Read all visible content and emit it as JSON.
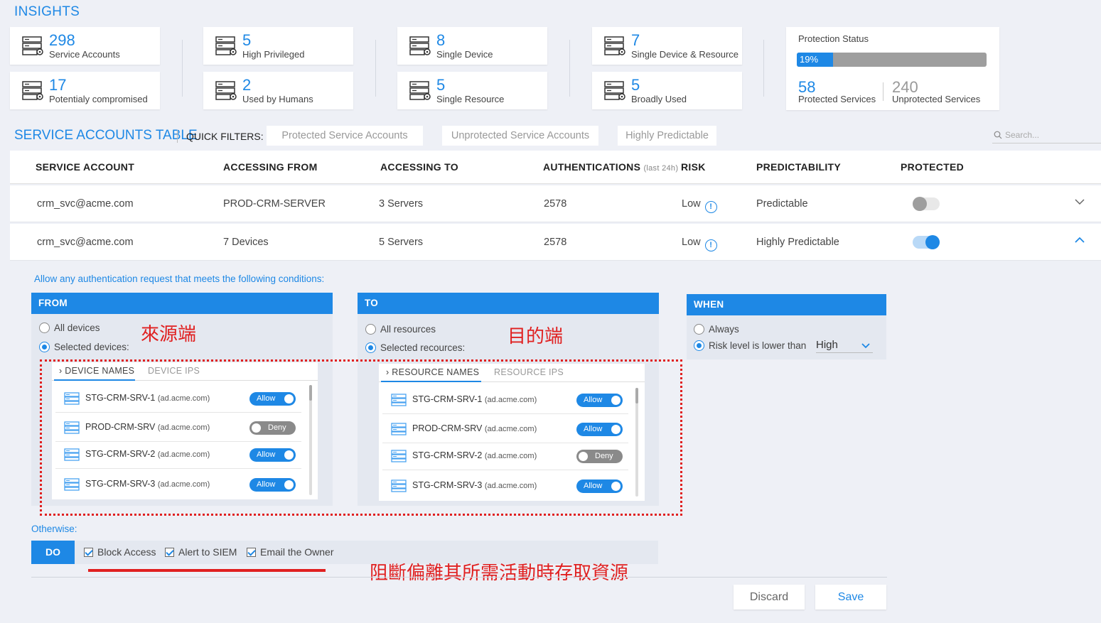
{
  "insights": {
    "title": "INSIGHTS",
    "cards": [
      {
        "num": "298",
        "label": "Service Accounts"
      },
      {
        "num": "5",
        "label": "High Privileged"
      },
      {
        "num": "8",
        "label": "Single Device"
      },
      {
        "num": "7",
        "label": "Single Device & Resource"
      },
      {
        "num": "17",
        "label": "Potentialy compromised"
      },
      {
        "num": "2",
        "label": "Used by Humans"
      },
      {
        "num": "5",
        "label": "Single Resource"
      },
      {
        "num": "5",
        "label": "Broadly Used"
      }
    ],
    "protection": {
      "title": "Protection Status",
      "percent_label": "19%",
      "percent": 19,
      "protected_num": "58",
      "protected_label": "Protected Services",
      "unprotected_num": "240",
      "unprotected_label": "Unprotected Services"
    }
  },
  "table": {
    "title": "SERVICE ACCOUNTS TABLE",
    "quick_filters_label": "QUICK FILTERS:",
    "filters": [
      "Protected Service Accounts",
      "Unprotected Service Accounts",
      "Highly Predictable"
    ],
    "search_placeholder": "Search...",
    "headers": {
      "account": "SERVICE ACCOUNT",
      "from": "ACCESSING FROM",
      "to": "ACCESSING TO",
      "auth": "AUTHENTICATIONS",
      "auth_note": "(last 24h)",
      "risk": "RISK",
      "pred": "PREDICTABILITY",
      "prot": "PROTECTED"
    },
    "rows": [
      {
        "account": "crm_svc@acme.com",
        "from": "PROD-CRM-SERVER",
        "to": "3 Servers",
        "auth": "2578",
        "risk": "Low",
        "pred": "Predictable",
        "protected": false
      },
      {
        "account": "crm_svc@acme.com",
        "from": "7 Devices",
        "to": "5 Servers",
        "auth": "2578",
        "risk": "Low",
        "pred": "Highly Predictable",
        "protected": true
      }
    ]
  },
  "policy": {
    "intro": "Allow any authentication request that meets the following conditions:",
    "from": {
      "header": "FROM",
      "opt_all": "All devices",
      "opt_selected": "Selected devices:",
      "annotation": "來源端",
      "tab_names": "DEVICE NAMES",
      "tab_ips": "DEVICE IPS",
      "items": [
        {
          "name": "STG-CRM-SRV-1",
          "domain": "(ad.acme.com)",
          "state": "Allow"
        },
        {
          "name": "PROD-CRM-SRV",
          "domain": "(ad.acme.com)",
          "state": "Deny"
        },
        {
          "name": "STG-CRM-SRV-2",
          "domain": "(ad.acme.com)",
          "state": "Allow"
        },
        {
          "name": "STG-CRM-SRV-3",
          "domain": "(ad.acme.com)",
          "state": "Allow"
        }
      ]
    },
    "to": {
      "header": "TO",
      "opt_all": "All resources",
      "opt_selected": "Selected recources:",
      "annotation": "目的端",
      "tab_names": "RESOURCE NAMES",
      "tab_ips": "RESOURCE IPS",
      "items": [
        {
          "name": "STG-CRM-SRV-1",
          "domain": "(ad.acme.com)",
          "state": "Allow"
        },
        {
          "name": "PROD-CRM-SRV",
          "domain": "(ad.acme.com)",
          "state": "Allow"
        },
        {
          "name": "STG-CRM-SRV-2",
          "domain": "(ad.acme.com)",
          "state": "Deny"
        },
        {
          "name": "STG-CRM-SRV-3",
          "domain": "(ad.acme.com)",
          "state": "Allow"
        }
      ]
    },
    "when": {
      "header": "WHEN",
      "opt_always": "Always",
      "opt_risk": "Risk level is lower than",
      "risk_value": "High"
    },
    "otherwise": "Otherwise:",
    "do_label": "DO",
    "actions": [
      "Block Access",
      "Alert to SIEM",
      "Email the Owner"
    ],
    "annotation_bottom": "阻斷偏離其所需活動時存取資源",
    "discard": "Discard",
    "save": "Save"
  },
  "colors": {
    "accent": "#1e88e5",
    "annotation": "#e02020"
  }
}
